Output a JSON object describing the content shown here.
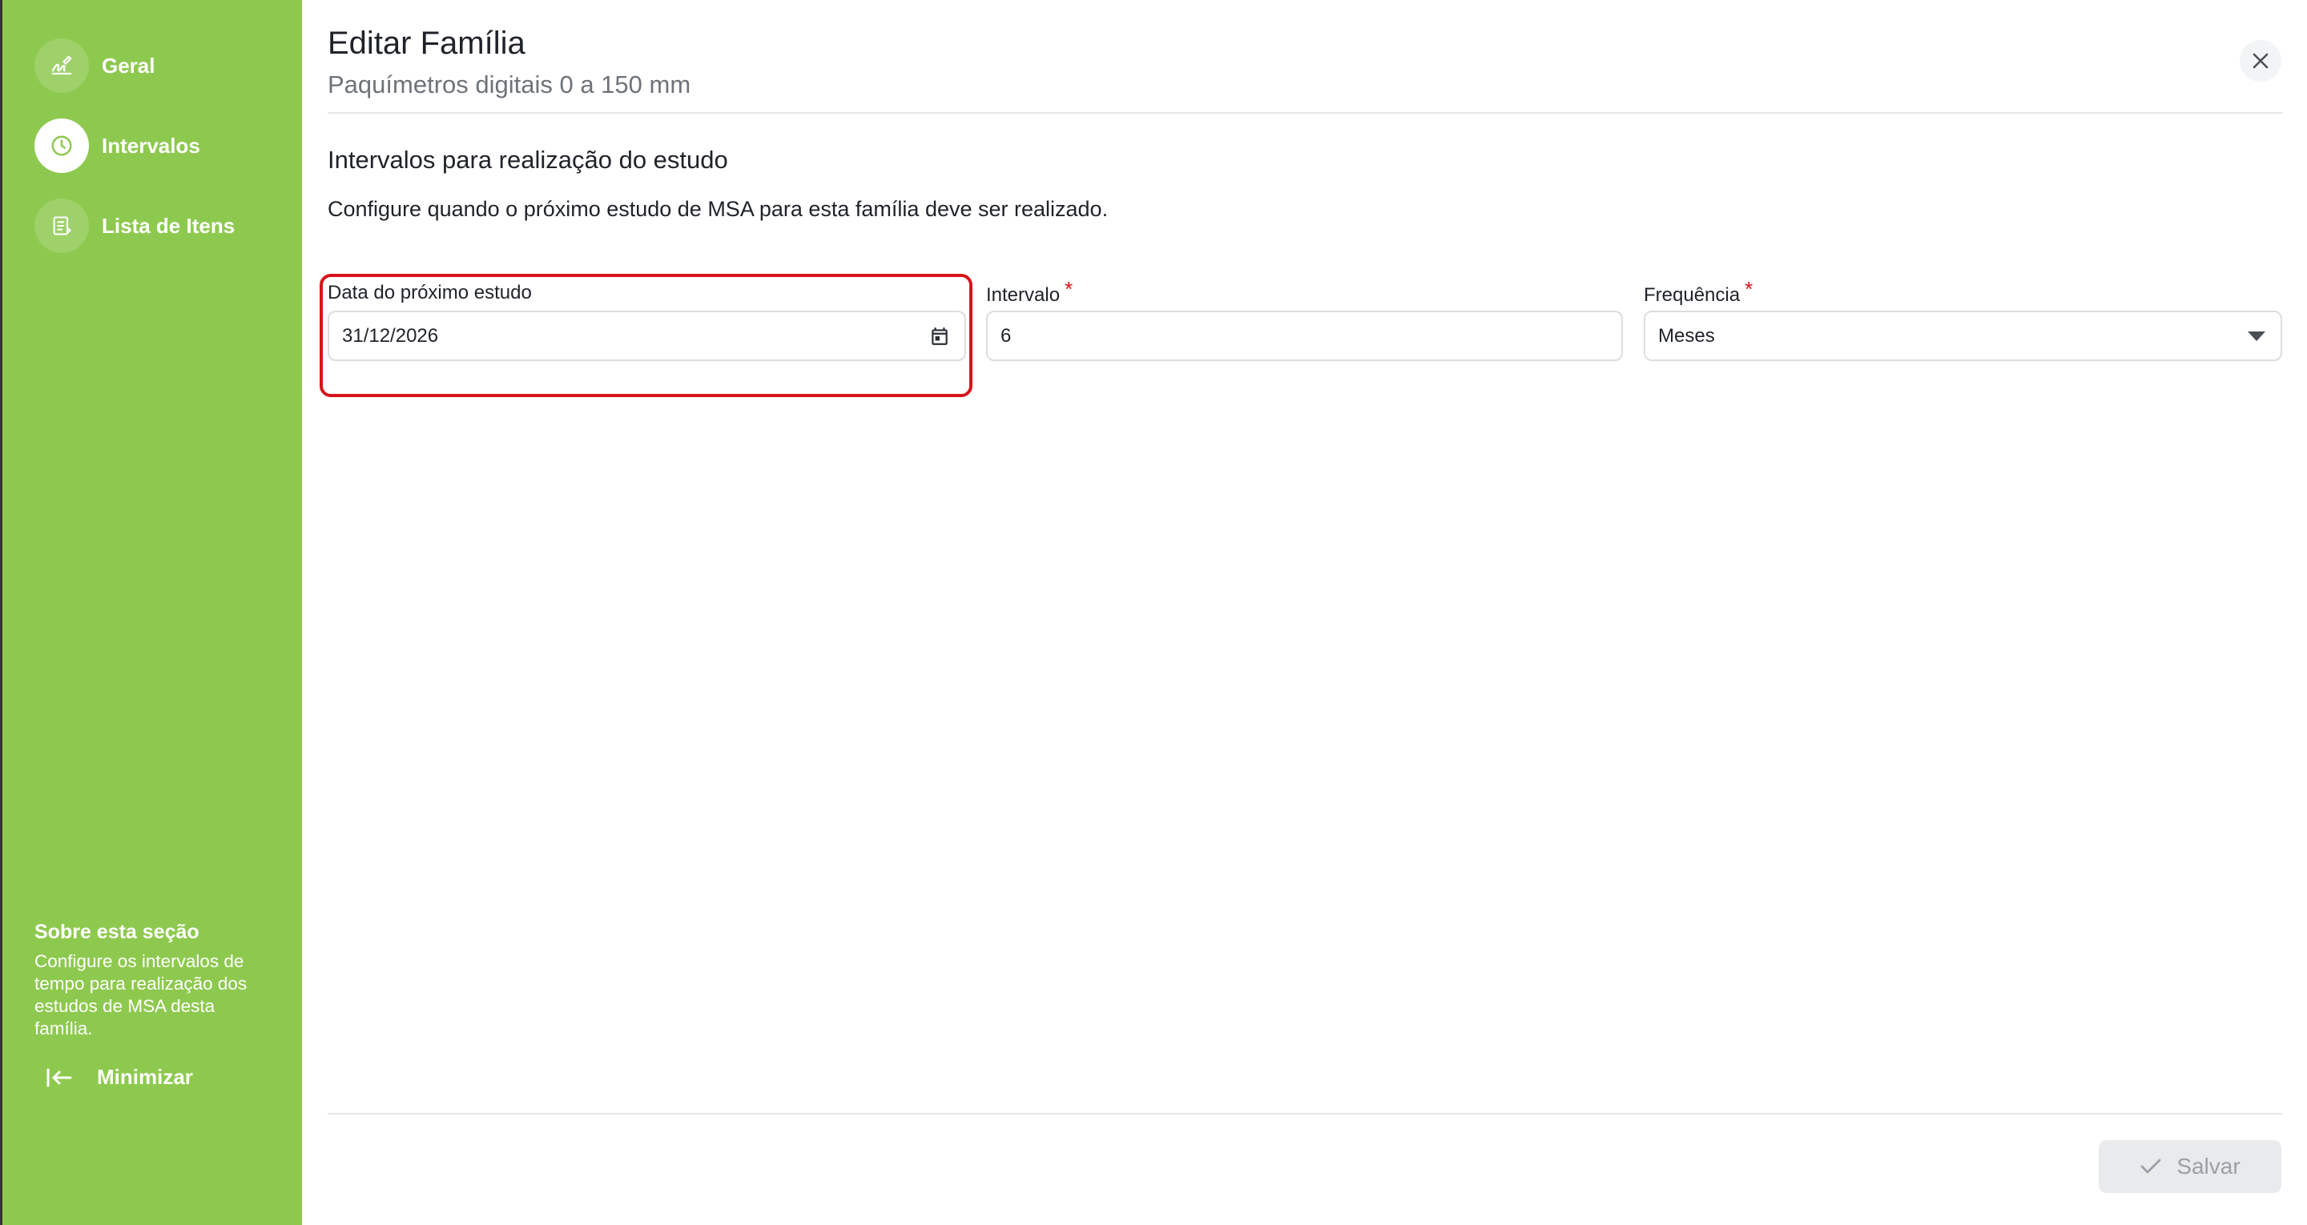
{
  "sidebar": {
    "items": [
      {
        "label": "Geral",
        "icon": "signature-icon",
        "active": false
      },
      {
        "label": "Intervalos",
        "icon": "clock-icon",
        "active": true
      },
      {
        "label": "Lista de Itens",
        "icon": "list-icon",
        "active": false
      }
    ],
    "about_title": "Sobre esta seção",
    "about_text": "Configure os intervalos de tempo para realização dos estudos de MSA desta família.",
    "minimize_label": "Minimizar",
    "color": "#8ec94f"
  },
  "header": {
    "title": "Editar Família",
    "subtitle": "Paquímetros digitais 0 a 150 mm"
  },
  "section": {
    "title": "Intervalos para realização do estudo",
    "description": "Configure quando o próximo estudo de MSA para esta família deve ser realizado."
  },
  "form": {
    "next_date": {
      "label": "Data do próximo estudo",
      "value": "31/12/2026"
    },
    "interval": {
      "label": "Intervalo",
      "required_mark": "*",
      "value": "6"
    },
    "frequency": {
      "label": "Frequência",
      "required_mark": "*",
      "value": "Meses"
    }
  },
  "footer": {
    "save_label": "Salvar"
  },
  "colors": {
    "accent": "#8ec94f",
    "highlight": "#d7141a",
    "required": "#d7141a"
  }
}
